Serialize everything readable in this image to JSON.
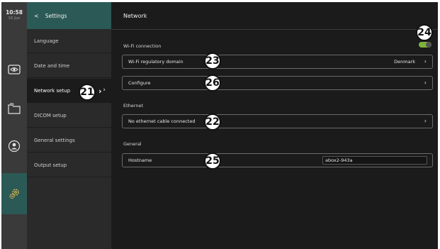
{
  "status": {
    "time": "10:58",
    "date": "10 Jun"
  },
  "rail": {
    "icons": [
      "live-view-icon",
      "folder-icon",
      "patient-icon",
      "settings-gear-icon"
    ],
    "active": "settings-gear-icon"
  },
  "menu": {
    "back_glyph": "<",
    "title": "Settings",
    "items": [
      {
        "label": "Language"
      },
      {
        "label": "Date and time"
      },
      {
        "label": "Network setup",
        "active": true
      },
      {
        "label": "DICOM setup"
      },
      {
        "label": "General settings"
      },
      {
        "label": "Output setup"
      }
    ],
    "chevron": "›"
  },
  "main": {
    "title": "Network",
    "wifi": {
      "section_label": "Wi-Fi connection",
      "toggle_on": true,
      "toggle_color": "#7fb33a",
      "regulatory_label": "Wi-Fi regulatory domain",
      "regulatory_value": "Denmark",
      "configure_label": "Configure"
    },
    "ethernet": {
      "section_label": "Ethernet",
      "status_label": "No ethernet cable connected"
    },
    "general": {
      "section_label": "General",
      "hostname_label": "Hostname",
      "hostname_value": "abox2-943a"
    },
    "chevron": "›"
  },
  "callouts": {
    "network_setup": "21",
    "ethernet": "22",
    "regulatory": "23",
    "toggle": "24",
    "hostname": "25",
    "configure": "26"
  },
  "colors": {
    "accent": "#2b5a56",
    "toggle": "#7fb33a",
    "background": "#1b1b1b"
  }
}
